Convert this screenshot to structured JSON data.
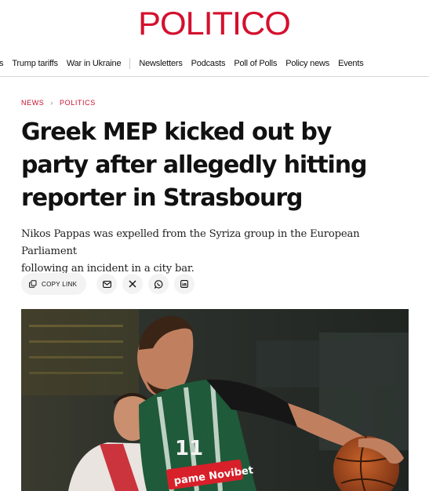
{
  "masthead": {
    "logo": "POLITICO"
  },
  "nav": {
    "topics": [
      "s",
      "Trump tariffs",
      "War in Ukraine"
    ],
    "links": [
      "Newsletters",
      "Podcasts",
      "Poll of Polls",
      "Policy news",
      "Events"
    ]
  },
  "breadcrumb": {
    "section": "NEWS",
    "subsection": "POLITICS"
  },
  "article": {
    "headline_lines": [
      "Greek MEP kicked out by",
      "party after allegedly hitting",
      "reporter in Strasbourg"
    ],
    "dek_lines": [
      "Nikos Pappas was expelled from the Syriza group in the European Parliament",
      "following an incident in a city bar."
    ]
  },
  "share": {
    "copy_link_label": "COPY LINK",
    "icons": [
      "email-icon",
      "x-icon",
      "whatsapp-icon",
      "linkedin-icon"
    ]
  },
  "photo": {
    "jersey_number": "11",
    "sponsor_text": "pame Novibet",
    "colors": {
      "jersey_green": "#1f5a3a",
      "opponent_red": "#c8202a"
    }
  },
  "colors": {
    "brand_red": "#d4102e",
    "breadcrumb_red": "#c8102e",
    "button_gray": "#f3f3f3"
  }
}
